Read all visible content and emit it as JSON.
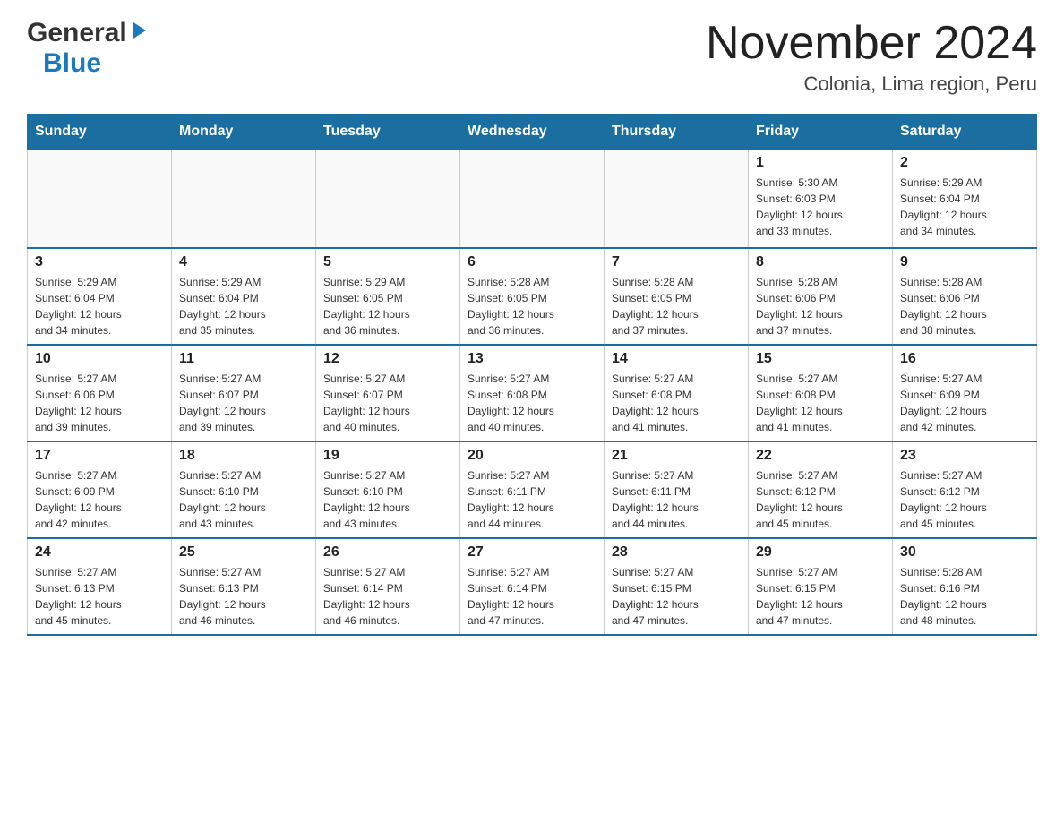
{
  "header": {
    "logo_general": "General",
    "logo_blue": "Blue",
    "month_title": "November 2024",
    "location": "Colonia, Lima region, Peru"
  },
  "weekdays": [
    "Sunday",
    "Monday",
    "Tuesday",
    "Wednesday",
    "Thursday",
    "Friday",
    "Saturday"
  ],
  "weeks": [
    [
      {
        "day": "",
        "info": ""
      },
      {
        "day": "",
        "info": ""
      },
      {
        "day": "",
        "info": ""
      },
      {
        "day": "",
        "info": ""
      },
      {
        "day": "",
        "info": ""
      },
      {
        "day": "1",
        "info": "Sunrise: 5:30 AM\nSunset: 6:03 PM\nDaylight: 12 hours\nand 33 minutes."
      },
      {
        "day": "2",
        "info": "Sunrise: 5:29 AM\nSunset: 6:04 PM\nDaylight: 12 hours\nand 34 minutes."
      }
    ],
    [
      {
        "day": "3",
        "info": "Sunrise: 5:29 AM\nSunset: 6:04 PM\nDaylight: 12 hours\nand 34 minutes."
      },
      {
        "day": "4",
        "info": "Sunrise: 5:29 AM\nSunset: 6:04 PM\nDaylight: 12 hours\nand 35 minutes."
      },
      {
        "day": "5",
        "info": "Sunrise: 5:29 AM\nSunset: 6:05 PM\nDaylight: 12 hours\nand 36 minutes."
      },
      {
        "day": "6",
        "info": "Sunrise: 5:28 AM\nSunset: 6:05 PM\nDaylight: 12 hours\nand 36 minutes."
      },
      {
        "day": "7",
        "info": "Sunrise: 5:28 AM\nSunset: 6:05 PM\nDaylight: 12 hours\nand 37 minutes."
      },
      {
        "day": "8",
        "info": "Sunrise: 5:28 AM\nSunset: 6:06 PM\nDaylight: 12 hours\nand 37 minutes."
      },
      {
        "day": "9",
        "info": "Sunrise: 5:28 AM\nSunset: 6:06 PM\nDaylight: 12 hours\nand 38 minutes."
      }
    ],
    [
      {
        "day": "10",
        "info": "Sunrise: 5:27 AM\nSunset: 6:06 PM\nDaylight: 12 hours\nand 39 minutes."
      },
      {
        "day": "11",
        "info": "Sunrise: 5:27 AM\nSunset: 6:07 PM\nDaylight: 12 hours\nand 39 minutes."
      },
      {
        "day": "12",
        "info": "Sunrise: 5:27 AM\nSunset: 6:07 PM\nDaylight: 12 hours\nand 40 minutes."
      },
      {
        "day": "13",
        "info": "Sunrise: 5:27 AM\nSunset: 6:08 PM\nDaylight: 12 hours\nand 40 minutes."
      },
      {
        "day": "14",
        "info": "Sunrise: 5:27 AM\nSunset: 6:08 PM\nDaylight: 12 hours\nand 41 minutes."
      },
      {
        "day": "15",
        "info": "Sunrise: 5:27 AM\nSunset: 6:08 PM\nDaylight: 12 hours\nand 41 minutes."
      },
      {
        "day": "16",
        "info": "Sunrise: 5:27 AM\nSunset: 6:09 PM\nDaylight: 12 hours\nand 42 minutes."
      }
    ],
    [
      {
        "day": "17",
        "info": "Sunrise: 5:27 AM\nSunset: 6:09 PM\nDaylight: 12 hours\nand 42 minutes."
      },
      {
        "day": "18",
        "info": "Sunrise: 5:27 AM\nSunset: 6:10 PM\nDaylight: 12 hours\nand 43 minutes."
      },
      {
        "day": "19",
        "info": "Sunrise: 5:27 AM\nSunset: 6:10 PM\nDaylight: 12 hours\nand 43 minutes."
      },
      {
        "day": "20",
        "info": "Sunrise: 5:27 AM\nSunset: 6:11 PM\nDaylight: 12 hours\nand 44 minutes."
      },
      {
        "day": "21",
        "info": "Sunrise: 5:27 AM\nSunset: 6:11 PM\nDaylight: 12 hours\nand 44 minutes."
      },
      {
        "day": "22",
        "info": "Sunrise: 5:27 AM\nSunset: 6:12 PM\nDaylight: 12 hours\nand 45 minutes."
      },
      {
        "day": "23",
        "info": "Sunrise: 5:27 AM\nSunset: 6:12 PM\nDaylight: 12 hours\nand 45 minutes."
      }
    ],
    [
      {
        "day": "24",
        "info": "Sunrise: 5:27 AM\nSunset: 6:13 PM\nDaylight: 12 hours\nand 45 minutes."
      },
      {
        "day": "25",
        "info": "Sunrise: 5:27 AM\nSunset: 6:13 PM\nDaylight: 12 hours\nand 46 minutes."
      },
      {
        "day": "26",
        "info": "Sunrise: 5:27 AM\nSunset: 6:14 PM\nDaylight: 12 hours\nand 46 minutes."
      },
      {
        "day": "27",
        "info": "Sunrise: 5:27 AM\nSunset: 6:14 PM\nDaylight: 12 hours\nand 47 minutes."
      },
      {
        "day": "28",
        "info": "Sunrise: 5:27 AM\nSunset: 6:15 PM\nDaylight: 12 hours\nand 47 minutes."
      },
      {
        "day": "29",
        "info": "Sunrise: 5:27 AM\nSunset: 6:15 PM\nDaylight: 12 hours\nand 47 minutes."
      },
      {
        "day": "30",
        "info": "Sunrise: 5:28 AM\nSunset: 6:16 PM\nDaylight: 12 hours\nand 48 minutes."
      }
    ]
  ]
}
